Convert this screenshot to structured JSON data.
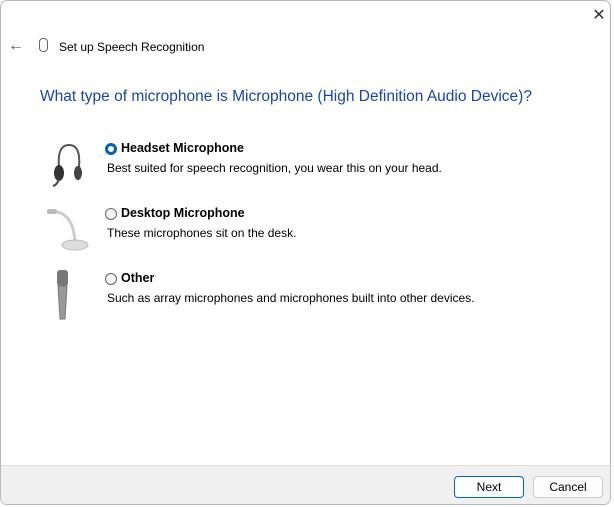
{
  "window": {
    "title": "Set up Speech Recognition"
  },
  "question": "What type of microphone is Microphone (High Definition Audio Device)?",
  "options": [
    {
      "label": "Headset Microphone",
      "description": "Best suited for speech recognition, you wear this on your head.",
      "selected": true
    },
    {
      "label": "Desktop Microphone",
      "description": "These microphones sit on the desk.",
      "selected": false
    },
    {
      "label": "Other",
      "description": "Such as array microphones and microphones built into other devices.",
      "selected": false
    }
  ],
  "buttons": {
    "next": "Next",
    "cancel": "Cancel"
  },
  "icons": {
    "close": "✕",
    "back": "←"
  }
}
